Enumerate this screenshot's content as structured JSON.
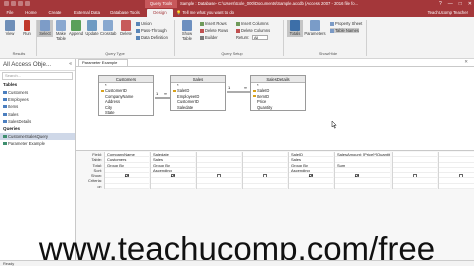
{
  "titlebar": {
    "context_label": "Query Tools",
    "title": "Sample : Database- C:\\Users\\tcole_000\\Documents\\Sample.accdb (Access 2007 - 2016 file fo...",
    "window_buttons": [
      "?",
      "—",
      "□",
      "✕"
    ]
  },
  "tabs": [
    {
      "label": "File"
    },
    {
      "label": "Home"
    },
    {
      "label": "Create"
    },
    {
      "label": "External Data"
    },
    {
      "label": "Database Tools"
    },
    {
      "label": "Design"
    }
  ],
  "tell_me": "Tell me what you want to do",
  "user": "TeachUcomp Teacher",
  "ribbon": {
    "results": {
      "run": "Run",
      "view": "View",
      "label": "Results"
    },
    "query_type": {
      "select": "Select",
      "make_table": "Make Table",
      "append": "Append",
      "update": "Update",
      "crosstab": "Crosstab",
      "delete": "Delete",
      "union": "Union",
      "pass_through": "Pass-Through",
      "data_definition": "Data Definition",
      "label": "Query Type"
    },
    "setup": {
      "show_table": "Show Table",
      "insert_rows": "Insert Rows",
      "delete_rows": "Delete Rows",
      "builder": "Builder",
      "insert_columns": "Insert Columns",
      "delete_columns": "Delete Columns",
      "return": "Return:",
      "return_value": "All",
      "label": "Query Setup"
    },
    "show_hide": {
      "totals": "Totals",
      "parameters": "Parameters",
      "property_sheet": "Property Sheet",
      "table_names": "Table Names",
      "label": "Show/Hide"
    }
  },
  "nav": {
    "title": "All Access Obje...",
    "search": "Search...",
    "groups": [
      {
        "name": "Tables",
        "items": [
          "Customers",
          "Employees",
          "Items",
          "Sales",
          "SalesDetails"
        ]
      },
      {
        "name": "Queries",
        "items": [
          "CustomerSalesQuery",
          "Parameter Example"
        ]
      }
    ],
    "selected": "CustomerSalesQuery"
  },
  "doc_tab": "Parameter Example",
  "tables": [
    {
      "name": "Customers",
      "fields": [
        "*",
        "CustomerID",
        "CompanyName",
        "Address",
        "City",
        "State"
      ]
    },
    {
      "name": "Sales",
      "fields": [
        "*",
        "SaleID",
        "EmployeeID",
        "CustomerID",
        "Saledate"
      ]
    },
    {
      "name": "SalesDetails",
      "fields": [
        "*",
        "SaleID",
        "ItemID",
        "Price",
        "Quantity"
      ]
    }
  ],
  "grid": {
    "row_labels": [
      "Field:",
      "Table:",
      "Total:",
      "Sort:",
      "Show:",
      "Criteria:",
      "or:"
    ],
    "columns": [
      {
        "field": "CompanyName",
        "table": "Customers",
        "total": "Group By",
        "sort": "",
        "show": true
      },
      {
        "field": "Saledate",
        "table": "Sales",
        "total": "Group By",
        "sort": "Ascending",
        "show": true
      },
      {
        "field": "",
        "table": "",
        "total": "",
        "sort": "",
        "show": false
      },
      {
        "field": "",
        "table": "",
        "total": "",
        "sort": "",
        "show": false
      },
      {
        "field": "SaleID",
        "table": "Sales",
        "total": "Group By",
        "sort": "Ascending",
        "show": true
      },
      {
        "field": "SalesAmount: [Price]*[Quantity]",
        "table": "",
        "total": "Sum",
        "sort": "",
        "show": true
      },
      {
        "field": "",
        "table": "",
        "total": "",
        "sort": "",
        "show": false
      },
      {
        "field": "",
        "table": "",
        "total": "",
        "sort": "",
        "show": false
      }
    ]
  },
  "watermark": "www.teachucomp.com/free",
  "status": "Ready"
}
